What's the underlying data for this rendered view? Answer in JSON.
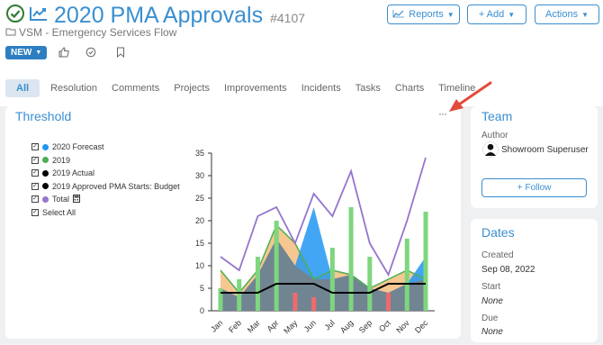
{
  "header": {
    "title": "2020 PMA Approvals",
    "item_id": "#4107",
    "breadcrumb": "VSM - Emergency Services Flow",
    "buttons": {
      "reports": "Reports",
      "add": "+ Add",
      "actions": "Actions"
    },
    "status": "NEW"
  },
  "tabs": [
    "All",
    "Resolution",
    "Comments",
    "Projects",
    "Improvements",
    "Incidents",
    "Tasks",
    "Charts",
    "Timeline"
  ],
  "threshold": {
    "title": "Threshold",
    "menu": "···",
    "legend": [
      {
        "label": "2020 Forecast",
        "color": "#2196f3"
      },
      {
        "label": "2019",
        "color": "#4caf50"
      },
      {
        "label": "2019 Actual",
        "color": "#000000"
      },
      {
        "label": "2019 Approved PMA Starts: Budget",
        "color": "#000000"
      },
      {
        "label": "Total",
        "color": "#9575cd"
      }
    ],
    "select_all": "Select All"
  },
  "chart_data": {
    "type": "area",
    "categories": [
      "Jan",
      "Feb",
      "Mar",
      "Apr",
      "May",
      "Jun",
      "Jul",
      "Aug",
      "Sep",
      "Oct",
      "Nov",
      "Dec"
    ],
    "ylim": [
      0,
      35
    ],
    "yticks": [
      "0",
      "5",
      "10",
      "15",
      "20",
      "25",
      "30",
      "35"
    ],
    "series": [
      {
        "name": "2020 Forecast",
        "kind": "area",
        "color": "#2196f3",
        "values": [
          5,
          3,
          8,
          16,
          10,
          23,
          7,
          8,
          5,
          4,
          6,
          12
        ]
      },
      {
        "name": "2019",
        "kind": "area",
        "color": "#f5c185",
        "values": [
          9,
          4,
          9,
          19,
          15,
          7,
          9,
          8,
          5,
          7,
          9,
          7
        ]
      },
      {
        "name": "2019 Actual",
        "kind": "line",
        "color": "#000000",
        "values": [
          4,
          4,
          4,
          6,
          6,
          6,
          4,
          4,
          4,
          6,
          6,
          6
        ]
      },
      {
        "name": "Total",
        "kind": "line",
        "color": "#9575cd",
        "values": [
          12,
          9,
          21,
          23,
          15,
          26,
          21,
          31,
          15,
          8,
          20,
          34
        ]
      },
      {
        "name": "2019 Approved PMA Starts: Budget",
        "kind": "bar",
        "values": [
          5,
          7,
          12,
          20,
          4,
          3,
          14,
          23,
          12,
          4,
          16,
          22
        ]
      }
    ]
  },
  "team": {
    "title": "Team",
    "author_label": "Author",
    "author_name": "Showroom Superuser",
    "follow": "Follow"
  },
  "dates": {
    "title": "Dates",
    "created_label": "Created",
    "created_value": "Sep 08, 2022",
    "start_label": "Start",
    "start_value": "None",
    "due_label": "Due",
    "due_value": "None"
  }
}
